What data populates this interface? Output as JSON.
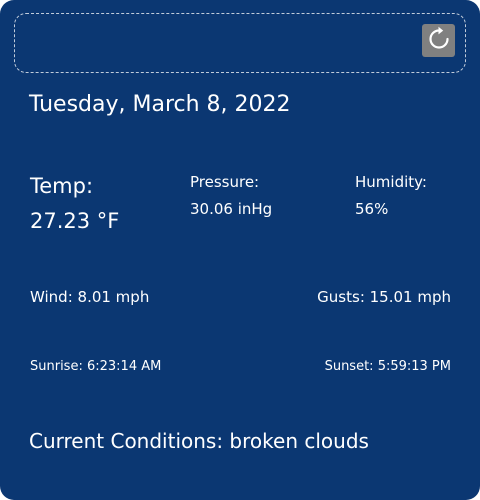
{
  "date": "Tuesday, March 8, 2022",
  "refresh_icon": "refresh-icon",
  "colors": {
    "card_background": "#0b3772",
    "text": "#ffffff",
    "refresh_button": "#808080"
  },
  "temp": {
    "label": "Temp:",
    "value": "27.23 °F"
  },
  "pressure": {
    "label": "Pressure:",
    "value": "30.06 inHg"
  },
  "humidity": {
    "label": "Humidity:",
    "value": "56%"
  },
  "wind": "Wind: 8.01 mph",
  "gusts": "Gusts: 15.01 mph",
  "sunrise": "Sunrise: 6:23:14 AM",
  "sunset": "Sunset: 5:59:13 PM",
  "conditions": "Current Conditions: broken clouds"
}
